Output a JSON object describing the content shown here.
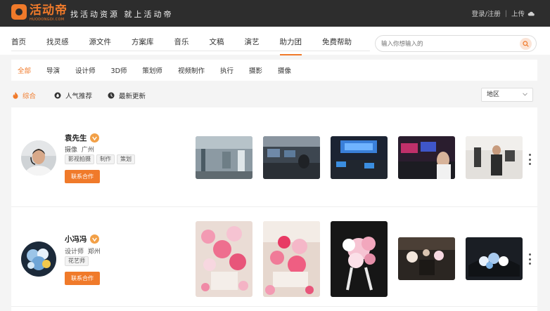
{
  "brand": {
    "logo_cn": "活动帝",
    "logo_en": "HUODONGDI.COM",
    "slogan": "找活动资源 就上活动帝",
    "accent": "#f07a2a"
  },
  "header": {
    "login": "登录/注册",
    "upload": "上传"
  },
  "nav": {
    "items": [
      "首页",
      "找灵感",
      "源文件",
      "方案库",
      "音乐",
      "文稿",
      "演艺",
      "助力团",
      "免费帮助"
    ],
    "active": "助力团"
  },
  "search": {
    "placeholder": "输入你想输入的"
  },
  "categories": {
    "items": [
      "全部",
      "导演",
      "设计师",
      "3D师",
      "策划师",
      "视频制作",
      "执行",
      "摄影",
      "摄像"
    ],
    "active": "全部"
  },
  "sort": {
    "items": [
      "综合",
      "人气推荐",
      "最新更新"
    ],
    "active": "综合",
    "region": "地区"
  },
  "people": [
    {
      "name": "袁先生",
      "role": "摄像",
      "city": "广州",
      "tags": [
        "影视拍摄",
        "制作",
        "策划"
      ],
      "contact": "联系合作"
    },
    {
      "name": "小冯冯",
      "role": "设计师",
      "city": "郑州",
      "tags": [
        "花艺师"
      ],
      "contact": "联系合作"
    }
  ]
}
